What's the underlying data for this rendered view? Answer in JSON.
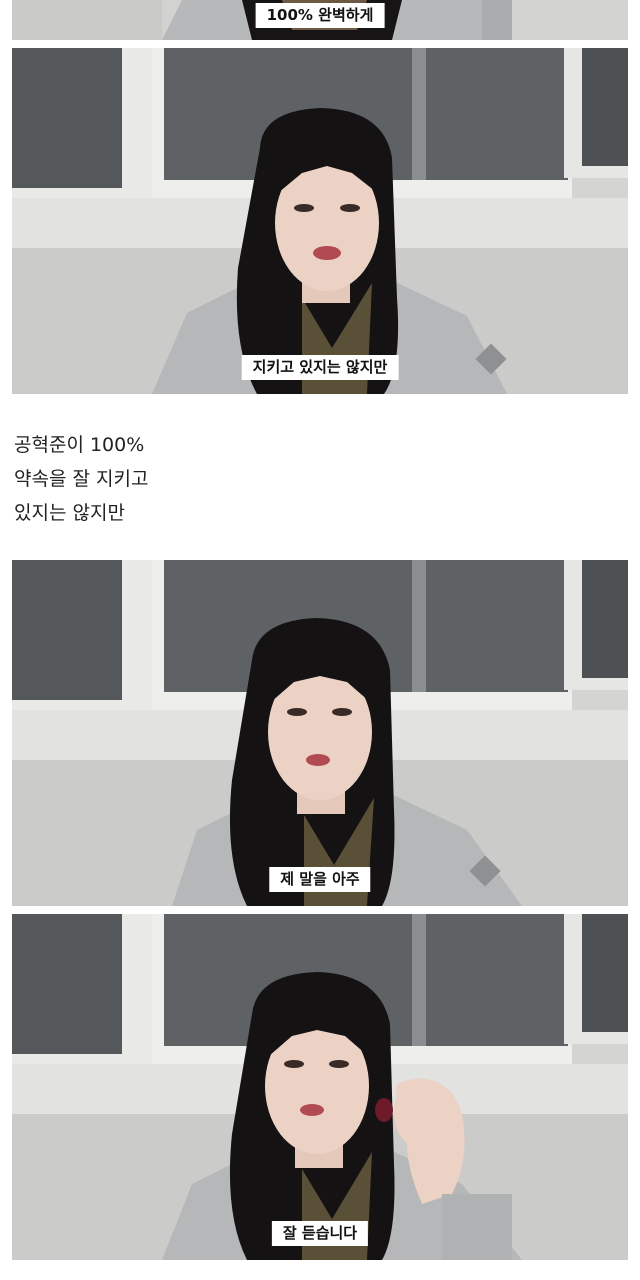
{
  "frames": [
    {
      "subtitle": "100% 완벽하게"
    },
    {
      "subtitle": "지키고 있지는 않지만"
    },
    {
      "subtitle": "제 말을 아주"
    },
    {
      "subtitle": "잘 듣습니다"
    }
  ],
  "caption": {
    "lines": [
      "공혁준이 100%",
      "약속을 잘 지키고",
      "있지는 않지만"
    ]
  },
  "colors": {
    "wall": "#d6d6d4",
    "window_dark": "#5c6062",
    "hoodie": "#b4b6b8",
    "hair": "#141212",
    "skin": "#ecd2c4",
    "lips": "#b24a52"
  }
}
